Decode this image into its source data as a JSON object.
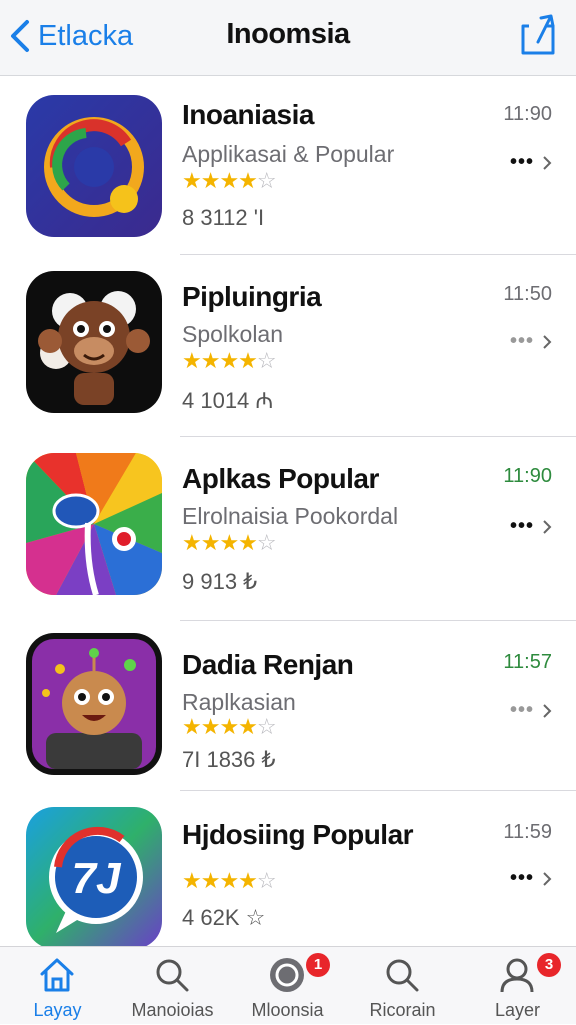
{
  "nav": {
    "back_label": "Etlacka",
    "title": "Inoomsia"
  },
  "apps": [
    {
      "name": "Inoaniasia",
      "subtitle": "Applikasai & Popular",
      "rating": "4 of 5",
      "meta": "8 3112 'I",
      "time": "11:90",
      "time_color": "#6d6d72",
      "more": "•••",
      "icon": "swirl-logo-icon"
    },
    {
      "name": "Pipluingria",
      "subtitle": "Spolkolan",
      "rating": "4 of 5",
      "meta": "4 1014 ₼",
      "time": "11:50",
      "time_color": "#6d6d72",
      "more": "•••",
      "icon": "monkey-character-icon"
    },
    {
      "name": "Aplkas Popular",
      "subtitle": "Elrolnaisia Pookordal",
      "rating": "4 of 5",
      "meta": "9 913 ₺",
      "time": "11:90",
      "time_color": "#2e8b3e",
      "more": "•••",
      "icon": "rainbow-swirl-icon"
    },
    {
      "name": "Dadia Renjan",
      "subtitle": "Raplkasian",
      "rating": "4 of 5",
      "meta": "7I 1836 ₺",
      "time": "11:57",
      "time_color": "#2e8b3e",
      "more": "•••",
      "icon": "robot-character-icon"
    },
    {
      "name": "Hjdosiing Popular",
      "subtitle": "",
      "rating": "4 of 5",
      "meta": "4 62K ☆",
      "time": "11:59",
      "time_color": "#6d6d72",
      "more": "•••",
      "icon": "chat-bubble-logo-icon"
    }
  ],
  "tabs": [
    {
      "label": "Layay",
      "icon": "home-icon",
      "active": true,
      "badge": ""
    },
    {
      "label": "Manoioias",
      "icon": "search-icon",
      "active": false,
      "badge": ""
    },
    {
      "label": "Mloonsia",
      "icon": "chat-bubble-icon",
      "active": false,
      "badge": "1"
    },
    {
      "label": "Ricorain",
      "icon": "search-icon",
      "active": false,
      "badge": ""
    },
    {
      "label": "Layer",
      "icon": "profile-icon",
      "active": false,
      "badge": "3"
    }
  ],
  "colors": {
    "accent": "#1a7fe8",
    "star": "#f4b400",
    "badge": "#e8262b"
  }
}
